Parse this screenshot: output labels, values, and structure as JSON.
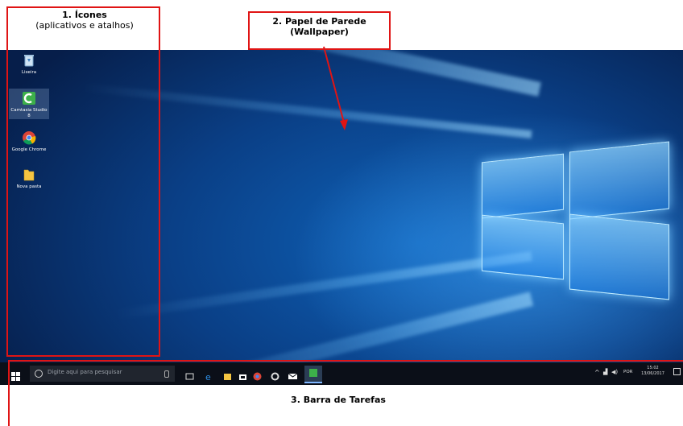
{
  "annotations": {
    "icons": {
      "title": "1. Ícones",
      "subtitle": "(aplicativos e atalhos)"
    },
    "wallpaper": {
      "title": "2. Papel de Parede",
      "subtitle": "(Wallpaper)"
    },
    "taskbar": {
      "title": "3. Barra de Tarefas"
    }
  },
  "desktop_icons": [
    {
      "label": "Lixeira",
      "icon": "recycle-bin-icon"
    },
    {
      "label": "Camtasia Studio 8",
      "icon": "camtasia-icon"
    },
    {
      "label": "Google Chrome",
      "icon": "chrome-icon"
    },
    {
      "label": "Nova pasta",
      "icon": "folder-icon"
    }
  ],
  "taskbar": {
    "search_placeholder": "Digite aqui para pesquisar",
    "language": "POR",
    "time": "15:02",
    "date": "13/06/2017",
    "apps": [
      "task-view-icon",
      "edge-icon",
      "file-explorer-icon",
      "store-icon",
      "chrome-icon",
      "settings-icon",
      "mail-icon",
      "camtasia-icon"
    ]
  },
  "colors": {
    "annotation_red": "#e01414",
    "taskbar_bg": "#0b0f18",
    "wallpaper_blue": "#0f62b8"
  }
}
